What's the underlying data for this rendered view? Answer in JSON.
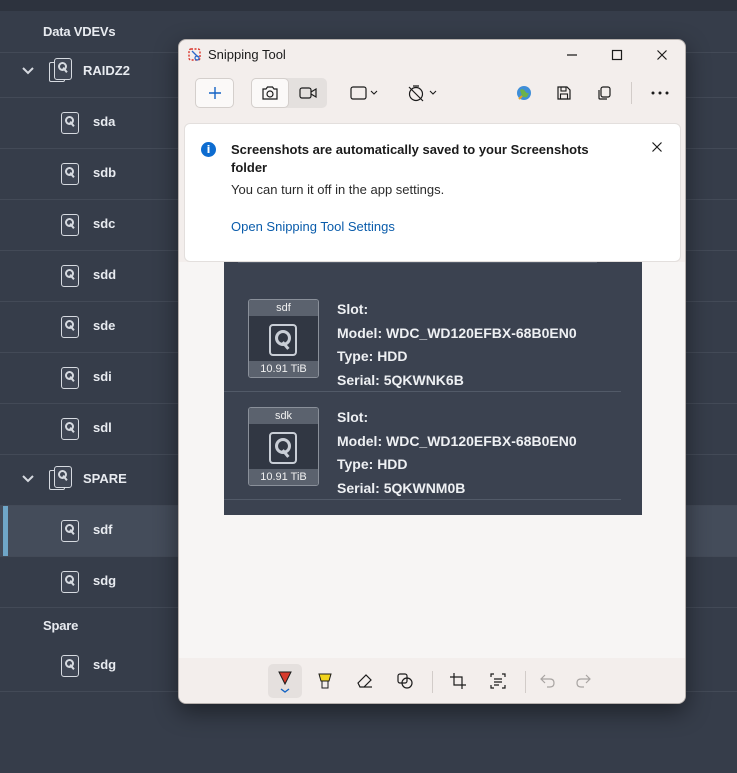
{
  "tree": {
    "data_vdevs_label": "Data VDEVs",
    "raidz2": {
      "label": "RAIDZ2",
      "disks": [
        "sda",
        "sdb",
        "sdc",
        "sdd",
        "sde",
        "sdi",
        "sdl"
      ]
    },
    "spare_group": {
      "label": "SPARE",
      "disks": [
        "sdf",
        "sdg"
      ],
      "selected": "sdf"
    },
    "spare_label": "Spare",
    "spare_disks": [
      "sdg"
    ]
  },
  "snipping_tool": {
    "title": "Snipping Tool",
    "banner": {
      "title": "Screenshots are automatically saved to your Screenshots folder",
      "body": "You can turn it off in the app settings.",
      "link": "Open Snipping Tool Settings"
    },
    "screenshot_disks": [
      {
        "name": "sdf",
        "size": "10.91 TiB",
        "slot": "Slot:",
        "model": "Model: WDC_WD120EFBX-68B0EN0",
        "type": "Type: HDD",
        "serial": "Serial: 5QKWNK6B"
      },
      {
        "name": "sdk",
        "size": "10.91 TiB",
        "slot": "Slot:",
        "model": "Model: WDC_WD120EFBX-68B0EN0",
        "type": "Type: HDD",
        "serial": "Serial: 5QKWNM0B"
      }
    ]
  },
  "colors": {
    "background": "#363d4a",
    "selection_accent": "#6fa6c8",
    "link": "#0a5cab",
    "info": "#0d6cd0"
  }
}
